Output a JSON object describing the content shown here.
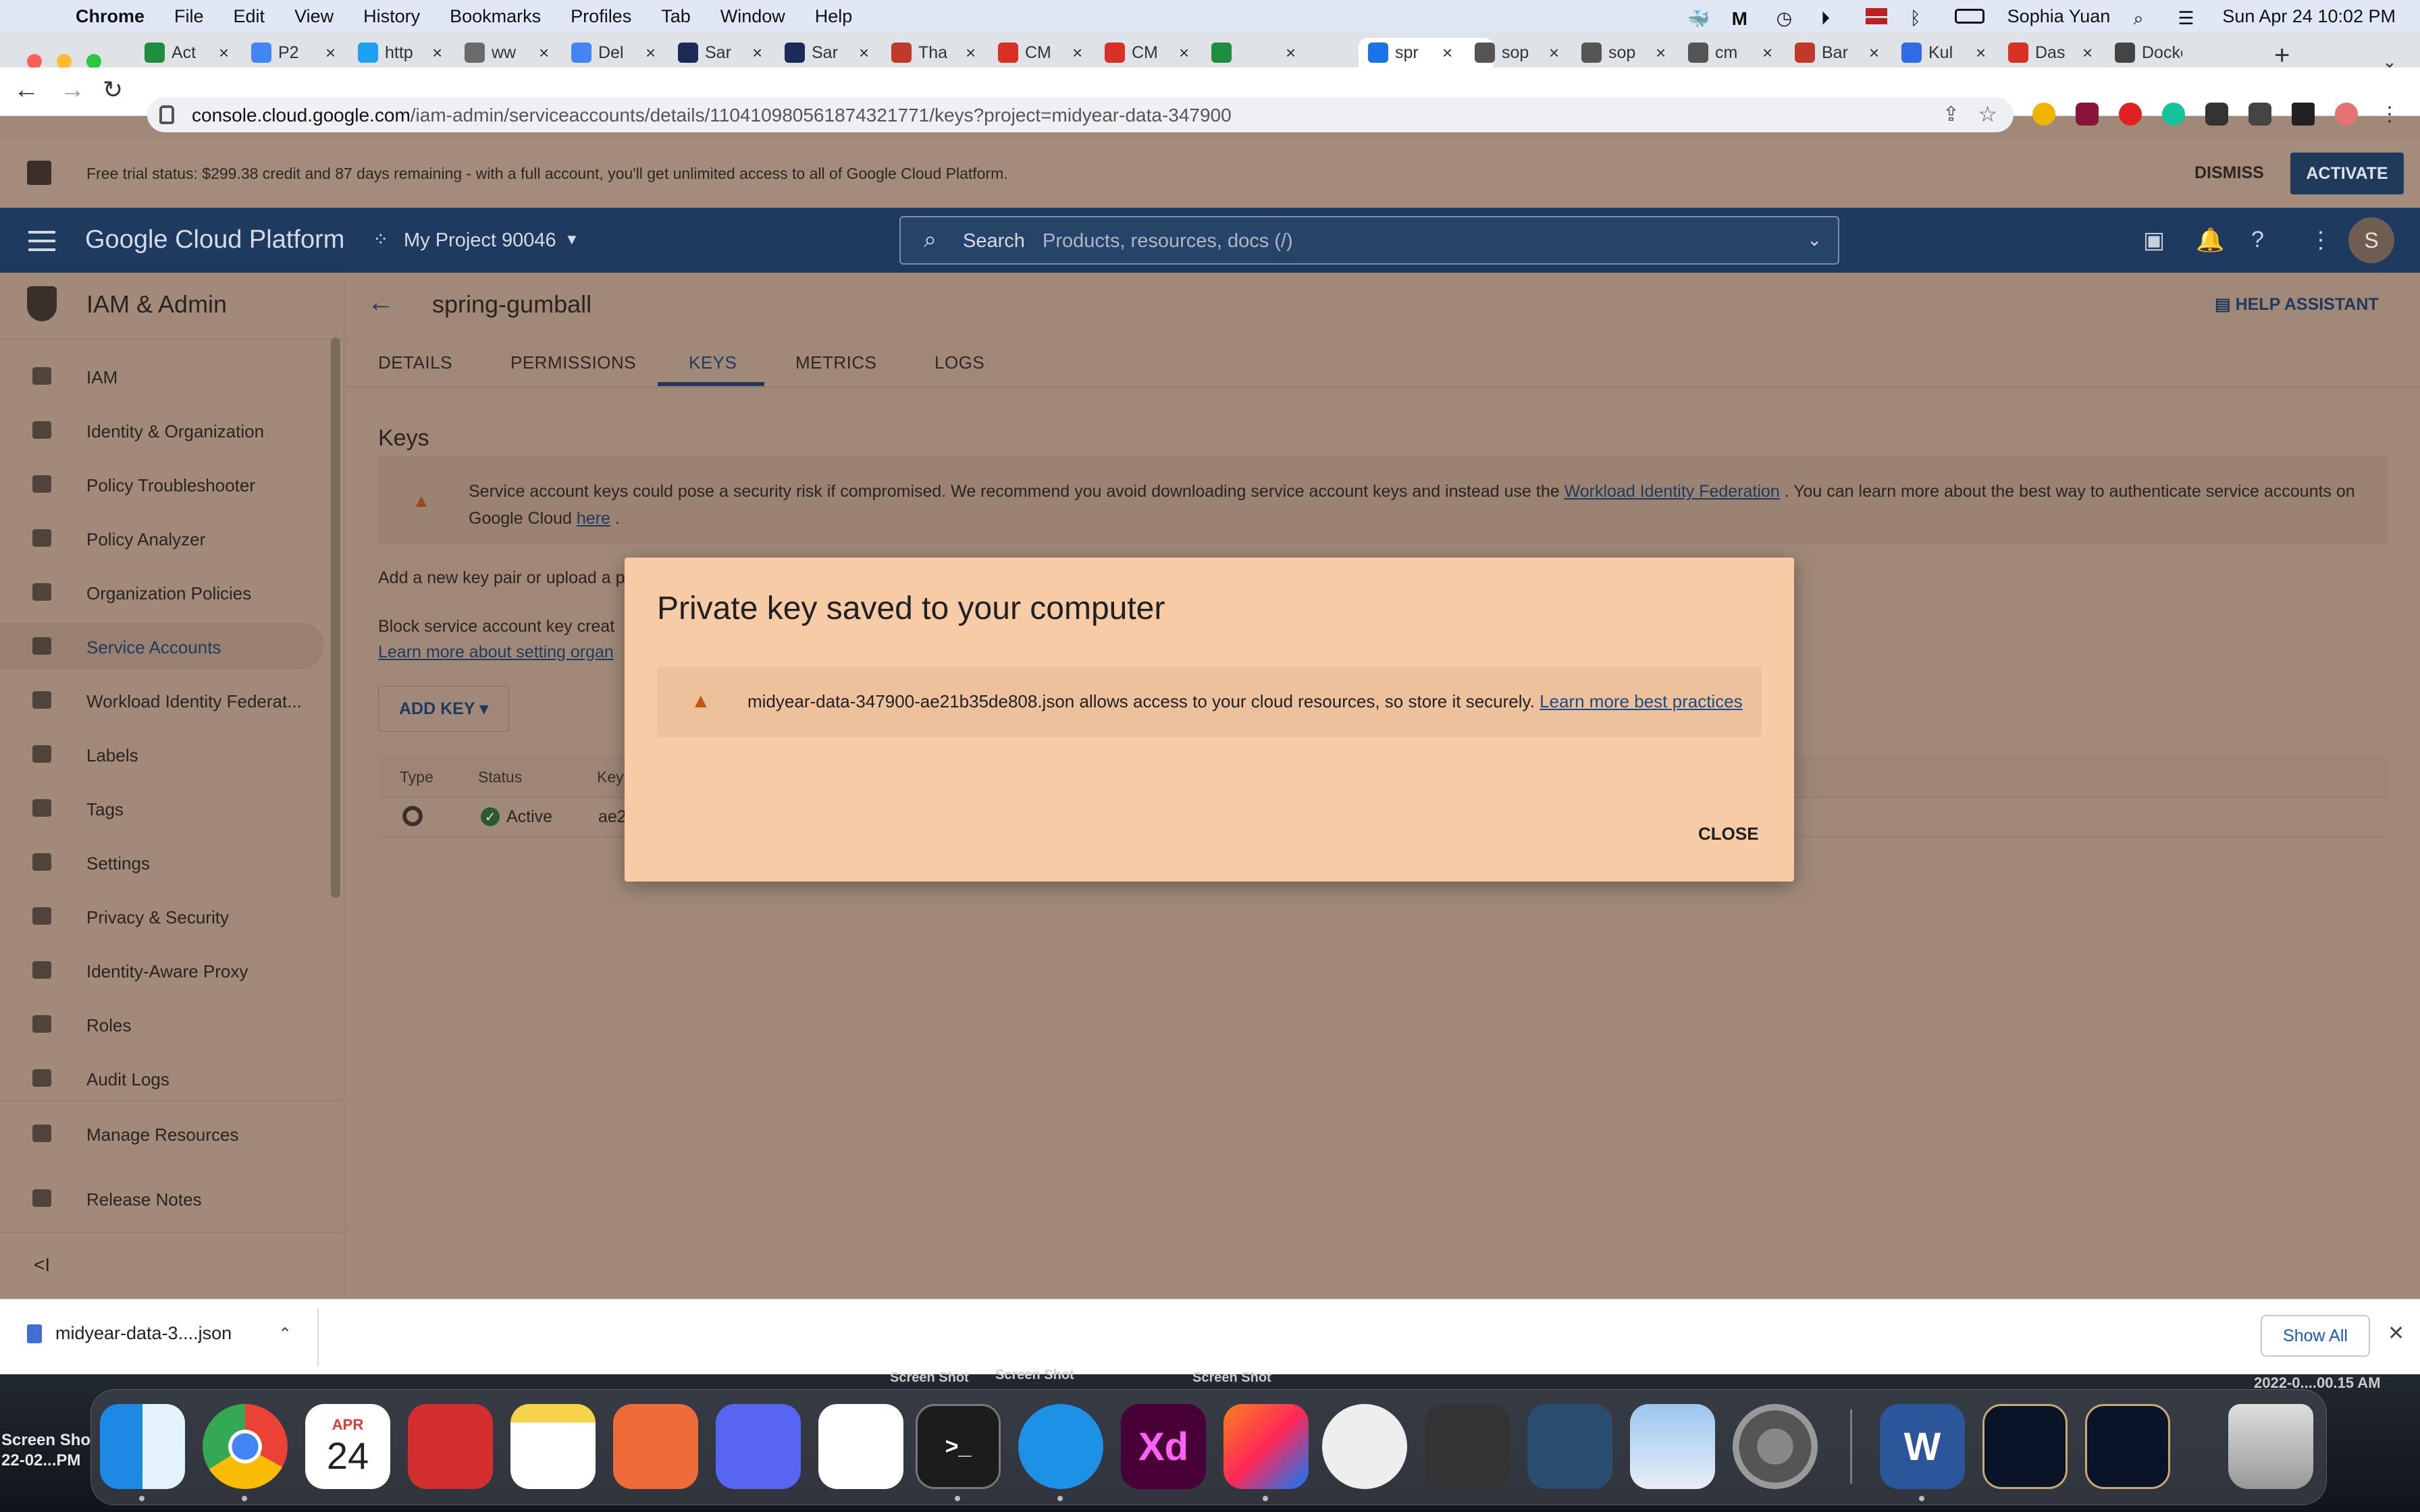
{
  "menubar": {
    "app": "Chrome",
    "items": [
      "File",
      "Edit",
      "View",
      "History",
      "Bookmarks",
      "Profiles",
      "Tab",
      "Window",
      "Help"
    ],
    "user": "Sophia Yuan",
    "datetime": "Sun Apr 24  10:02 PM"
  },
  "tabs": [
    {
      "title": "Act",
      "color": "#1e8e3e"
    },
    {
      "title": "P2",
      "color": "#4285f4"
    },
    {
      "title": "http",
      "color": "#1da1f2"
    },
    {
      "title": "ww",
      "color": "#6b6b6b"
    },
    {
      "title": "Del",
      "color": "#4285f4"
    },
    {
      "title": "Sar",
      "color": "#1c2a5a"
    },
    {
      "title": "Sar",
      "color": "#1c2a5a"
    },
    {
      "title": "Tha",
      "color": "#c0392b"
    },
    {
      "title": "CM",
      "color": "#d93025"
    },
    {
      "title": "CM",
      "color": "#d93025"
    },
    {
      "title": "",
      "color": "#1e8e3e"
    },
    {
      "title": "spr",
      "color": "#1a73e8"
    },
    {
      "title": "sop",
      "color": "#555555"
    },
    {
      "title": "sop",
      "color": "#555555"
    },
    {
      "title": "cm",
      "color": "#555555"
    },
    {
      "title": "Bar",
      "color": "#c0392b"
    },
    {
      "title": "Kul",
      "color": "#326ce5"
    },
    {
      "title": "Das",
      "color": "#d93025"
    },
    {
      "title": "Docker",
      "color": "#444444"
    }
  ],
  "address": {
    "host": "console.cloud.google.com",
    "path": "/iam-admin/serviceaccounts/details/110410980561874321771/keys?project=midyear-data-347900"
  },
  "banner": {
    "text": "Free trial status: $299.38 credit and 87 days remaining - with a full account, you'll get unlimited access to all of Google Cloud Platform.",
    "dismiss": "DISMISS",
    "activate": "ACTIVATE"
  },
  "gcp": {
    "title": "Google Cloud Platform",
    "project": "My Project 90046",
    "search_label": "Search",
    "search_placeholder": "Products, resources, docs (/)",
    "avatar": "S"
  },
  "sidebar": {
    "title": "IAM & Admin",
    "items": [
      {
        "label": "IAM"
      },
      {
        "label": "Identity & Organization"
      },
      {
        "label": "Policy Troubleshooter"
      },
      {
        "label": "Policy Analyzer"
      },
      {
        "label": "Organization Policies"
      },
      {
        "label": "Service Accounts"
      },
      {
        "label": "Workload Identity Federat..."
      },
      {
        "label": "Labels"
      },
      {
        "label": "Tags"
      },
      {
        "label": "Settings"
      },
      {
        "label": "Privacy & Security"
      },
      {
        "label": "Identity-Aware Proxy"
      },
      {
        "label": "Roles"
      },
      {
        "label": "Audit Logs"
      }
    ],
    "manage_resources": "Manage Resources",
    "release_notes": "Release Notes",
    "collapse": "<I"
  },
  "main": {
    "title": "spring-gumball",
    "help_assistant": "HELP ASSISTANT",
    "tabs": [
      "DETAILS",
      "PERMISSIONS",
      "KEYS",
      "METRICS",
      "LOGS"
    ],
    "keys_heading": "Keys",
    "warning_pre": "Service account keys could pose a security risk if compromised. We recommend you avoid downloading service account keys and instead use the",
    "warning_link": "Workload Identity Federation",
    "warning_mid": ". You can learn more about the best way to authenticate service accounts on Google Cloud",
    "warning_link2": "here",
    "warning_end": ".",
    "add_text": "Add a new key pair or upload a p",
    "block_text": "Block service account key creat",
    "learn_org": "Learn more about setting organ",
    "add_key": "ADD KEY",
    "table": {
      "headers": [
        "Type",
        "Status",
        "Key"
      ],
      "row": {
        "status": "Active",
        "key": "ae2"
      }
    }
  },
  "modal": {
    "title": "Private key saved to your computer",
    "message": "midyear-data-347900-ae21b35de808.json allows access to your cloud resources, so store it securely.",
    "link": "Learn more best practices",
    "close": "CLOSE"
  },
  "downloads": {
    "file": "midyear-data-3....json",
    "show_all": "Show All"
  },
  "desktop": {
    "left_label_1": "Screen Sho",
    "left_label_2": "22-02...PM",
    "shot1": "Screen Shot",
    "shot2": "Screen Shot",
    "shot3": "Screen Shot",
    "right_label": "2022-0....00.15 AM",
    "calendar_month": "APR",
    "calendar_day": "24"
  }
}
